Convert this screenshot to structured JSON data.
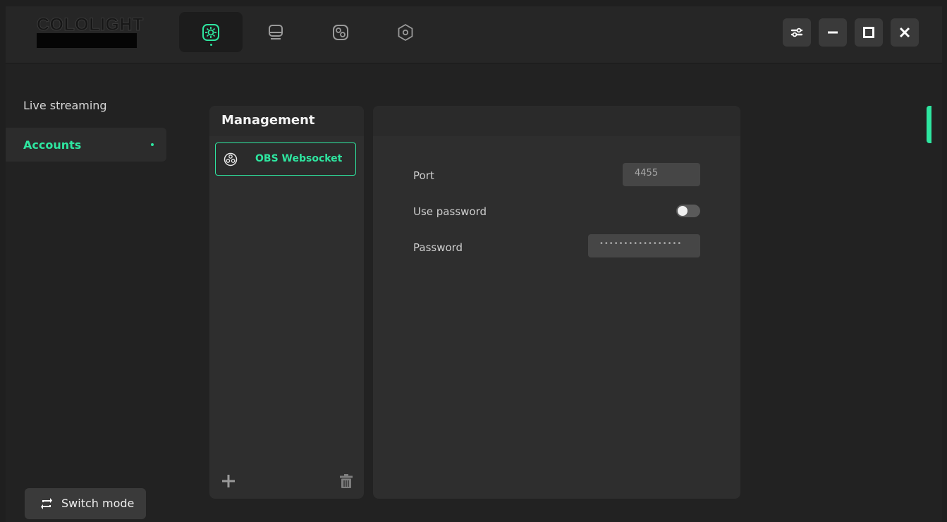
{
  "app": {
    "logo_text": "COLOLIGHT"
  },
  "nav": {
    "tabs": [
      {
        "icon": "light-scene-icon",
        "active": true
      },
      {
        "icon": "monitor-icon",
        "active": false
      },
      {
        "icon": "devices-icon",
        "active": false
      },
      {
        "icon": "settings-hex-icon",
        "active": false
      }
    ]
  },
  "window_controls": [
    "settings-sliders-icon",
    "minimize-icon",
    "maximize-icon",
    "close-icon"
  ],
  "sidebar": {
    "items": [
      {
        "label": "Live streaming",
        "active": false
      },
      {
        "label": "Accounts",
        "active": true
      }
    ],
    "switch_mode_label": "Switch mode"
  },
  "management": {
    "title": "Management",
    "items": [
      {
        "label": "OBS Websocket",
        "selected": true
      }
    ]
  },
  "details": {
    "port_label": "Port",
    "port_value": "4455",
    "use_password_label": "Use password",
    "use_password_on": false,
    "password_label": "Password",
    "password_value": "•••••••••••••••••"
  },
  "colors": {
    "accent": "#2ee6a0",
    "background": "#222222",
    "panel": "#2e2e2e"
  }
}
